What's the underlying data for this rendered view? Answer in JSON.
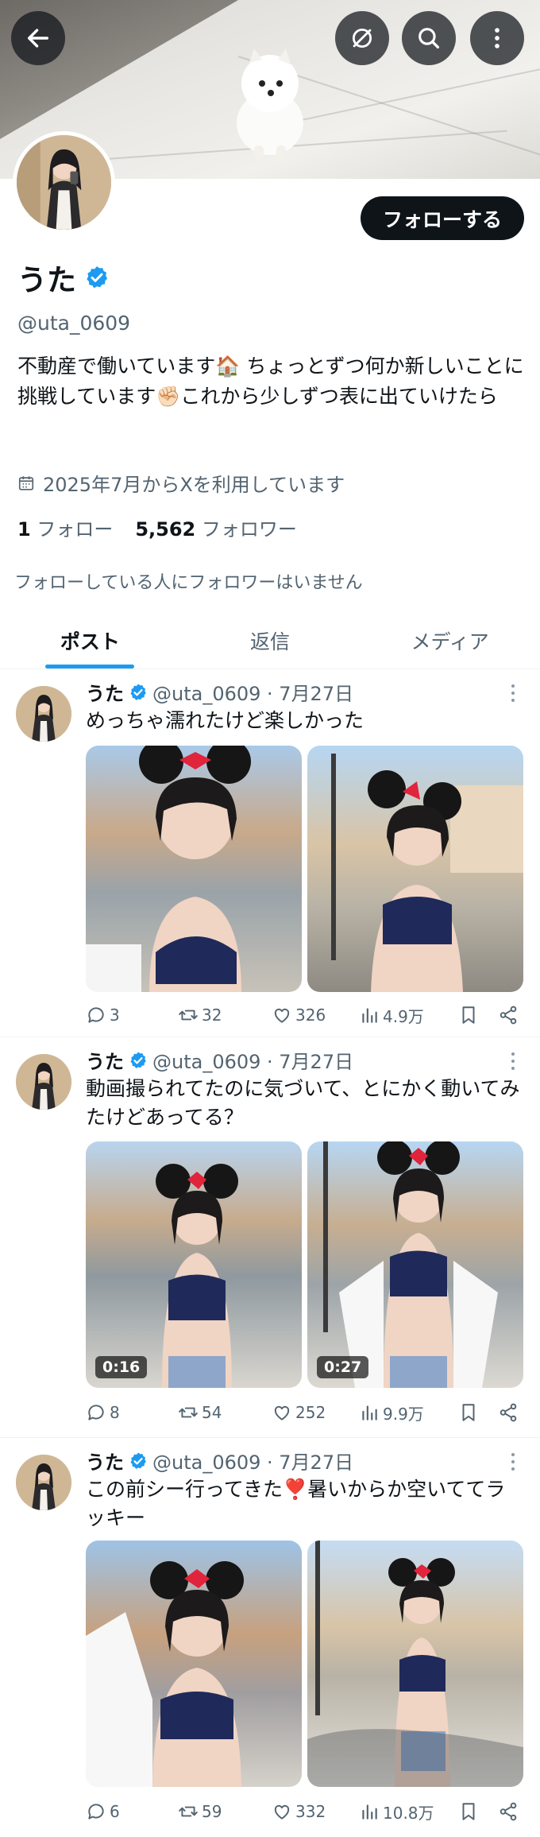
{
  "header": {
    "back_icon": "arrow-left-icon",
    "mute_icon": "mute-icon",
    "search_icon": "search-icon",
    "more_icon": "more-vertical-icon"
  },
  "profile": {
    "name": "うた",
    "handle": "@uta_0609",
    "follow_label": "フォローする",
    "bio": "不動産で働いています🏠 ちょっとずつ何か新しいことに挑戦しています✊🏻これから少しずつ表に出ていけたら",
    "joined": "2025年7月からXを利用しています",
    "following_count": "1",
    "following_label": "フォロー",
    "followers_count": "5,562",
    "followers_label": "フォロワー",
    "mutuals_note": "フォローしている人にフォロワーはいません"
  },
  "tabs": [
    {
      "label": "ポスト",
      "active": true
    },
    {
      "label": "返信",
      "active": false
    },
    {
      "label": "メディア",
      "active": false
    }
  ],
  "posts": [
    {
      "name": "うた",
      "meta": "@uta_0609 · 7月27日",
      "text": "めっちゃ濡れたけど楽しかった",
      "media": [
        {
          "duration": ""
        },
        {
          "duration": ""
        }
      ],
      "replies": "3",
      "reposts": "32",
      "likes": "326",
      "views": "4.9万"
    },
    {
      "name": "うた",
      "meta": "@uta_0609 · 7月27日",
      "text": "動画撮られてたのに気づいて、とにかく動いてみたけどあってる？",
      "media": [
        {
          "duration": "0:16"
        },
        {
          "duration": "0:27"
        }
      ],
      "replies": "8",
      "reposts": "54",
      "likes": "252",
      "views": "9.9万"
    },
    {
      "name": "うた",
      "meta": "@uta_0609 · 7月27日",
      "text": "この前シー行ってきた❣️暑いからか空いててラッキー",
      "media": [
        {
          "duration": ""
        },
        {
          "duration": ""
        }
      ],
      "replies": "6",
      "reposts": "59",
      "likes": "332",
      "views": "10.8万"
    }
  ],
  "colors": {
    "accent": "#1d9bf0",
    "text": "#0f1419",
    "muted": "#536471"
  }
}
